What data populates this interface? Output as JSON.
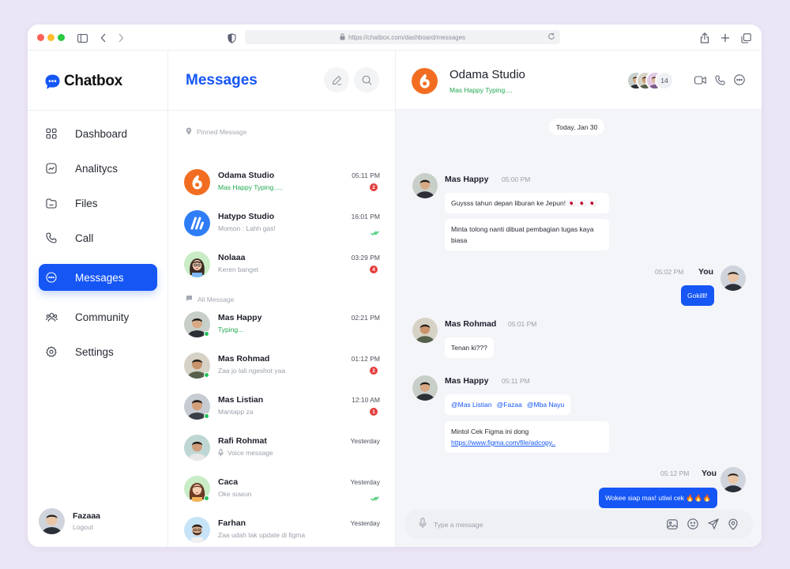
{
  "browser": {
    "url": "https://chatbox.com/dashboard/messages"
  },
  "brand": {
    "name": "Chatbox",
    "color": "#1556f5"
  },
  "sidebar": {
    "items": [
      {
        "label": "Dashboard",
        "icon": "grid-icon"
      },
      {
        "label": "Analitycs",
        "icon": "chart-icon"
      },
      {
        "label": "Files",
        "icon": "folder-icon"
      },
      {
        "label": "Call",
        "icon": "phone-icon"
      },
      {
        "label": "Messages",
        "icon": "chat-icon",
        "active": true
      },
      {
        "label": "Community",
        "icon": "users-icon"
      },
      {
        "label": "Settings",
        "icon": "gear-icon"
      }
    ],
    "user": {
      "name": "Fazaaa",
      "logout_label": "Logout"
    }
  },
  "messages_panel": {
    "title": "Messages",
    "pinned_label": "Pinned Message",
    "all_label": "All Message",
    "pinned": [
      {
        "name": "Odama Studio",
        "preview": "Mas Happy Typing.....",
        "time": "05:11 PM",
        "unread": "2",
        "typing": true
      },
      {
        "name": "Hatypo Studio",
        "preview": "Momon : Lahh gas!",
        "time": "16:01 PM",
        "read": true
      },
      {
        "name": "Nolaaa",
        "preview": "Keren banget",
        "time": "03:29 PM",
        "unread": "4"
      }
    ],
    "all": [
      {
        "name": "Mas Happy",
        "preview": "Typing...",
        "time": "02:21 PM",
        "typing": true,
        "online": true
      },
      {
        "name": "Mas Rohmad",
        "preview": "Zaa jo lali ngeshot yaa",
        "time": "01:12 PM",
        "unread": "2",
        "online": true
      },
      {
        "name": "Mas Listian",
        "preview": "Mantapp za",
        "time": "12:10 AM",
        "unread": "1",
        "online": true
      },
      {
        "name": "Rafi Rohmat",
        "preview": "Voice message",
        "time": "Yesterday",
        "voice": true
      },
      {
        "name": "Caca",
        "preview": "Oke suwun",
        "time": "Yesterday",
        "read": true,
        "online": true
      },
      {
        "name": "Farhan",
        "preview": "Zaa udah tak update di figma",
        "time": "Yesterday"
      }
    ]
  },
  "conversation": {
    "title": "Odama Studio",
    "status": "Mas Happy Typing....",
    "member_count": "14",
    "date_label": "Today, Jan 30",
    "msgs": {
      "m1_sender": "Mas Happy",
      "m1_time": "05:00 PM",
      "m1_text1": "Guysss tahun depan liburan ke Jepun! 🇯🇵 🇯🇵 🇯🇵",
      "m1_text2": "Minta tolong nanti dibuat pembagian tugas kaya biasa",
      "m2_sender": "You",
      "m2_time": "05:02 PM",
      "m2_text": "Gokilll!",
      "m3_sender": "Mas Rohmad",
      "m3_time": "05:01 PM",
      "m3_text": "Tenan ki???",
      "m4_sender": "Mas Happy",
      "m4_time": "05:11 PM",
      "m4_mention1": "@Mas Listian",
      "m4_mention2": "@Fazaa",
      "m4_mention3": "@Mba Nayu",
      "m4_text": "Mintol Cek Figma ini dong",
      "m4_link": "https://www.figma.com/file/adcopy..",
      "m5_sender": "You",
      "m5_time": "05:12 PM",
      "m5_text": "Wokee siap mas! utiwi cek 🔥🔥🔥"
    },
    "composer_placeholder": "Type a message"
  }
}
